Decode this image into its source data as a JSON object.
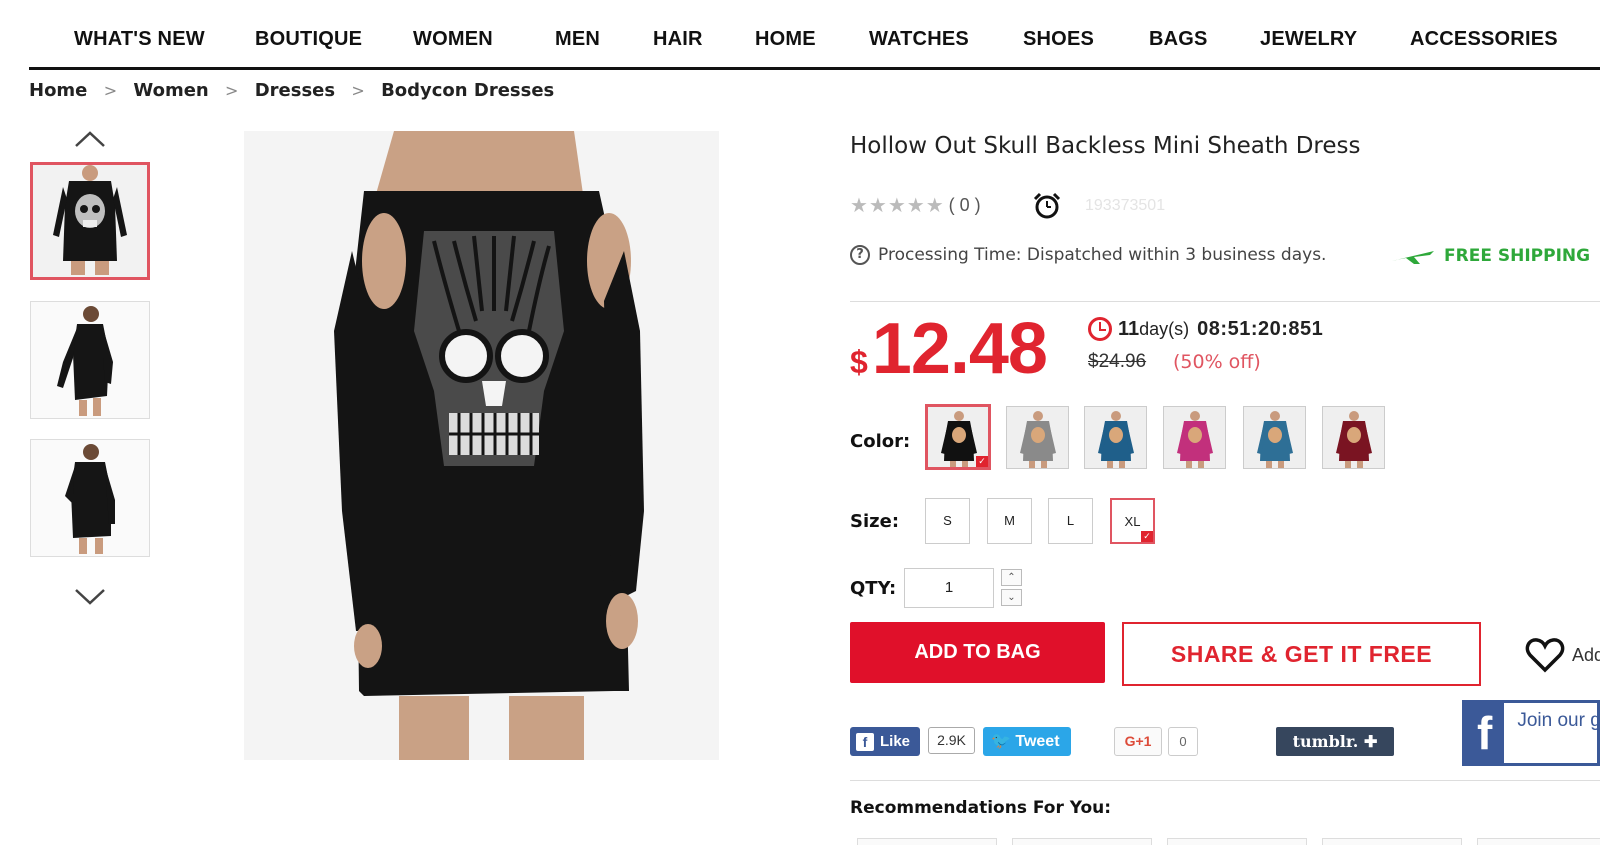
{
  "nav": {
    "items": [
      "WHAT'S NEW",
      "BOUTIQUE",
      "WOMEN",
      "MEN",
      "HAIR",
      "HOME",
      "WATCHES",
      "SHOES",
      "BAGS",
      "JEWELRY",
      "ACCESSORIES"
    ]
  },
  "breadcrumb": {
    "items": [
      "Home",
      "Women",
      "Dresses",
      "Bodycon Dresses"
    ],
    "separator": ">"
  },
  "product": {
    "title": "Hollow Out Skull Backless Mini Sheath Dress",
    "rating_stars": "★★★★★",
    "rating_count": "( 0 )",
    "sku": "193373501",
    "processing_time": "Processing Time: Dispatched within 3 business days.",
    "free_shipping": "FREE SHIPPING",
    "price_currency": "$",
    "price": "12.48",
    "timer_days": "11",
    "timer_days_unit": "day(s)",
    "timer_time": "08:51:20:851",
    "original_price": "$24.96",
    "discount": "(50% off)",
    "color_label": "Color:",
    "colors": [
      "#111111",
      "#8a8a8a",
      "#1f5f8a",
      "#c2307c",
      "#2e6f96",
      "#7a1422"
    ],
    "selected_color_index": 0,
    "size_label": "Size:",
    "sizes": [
      "S",
      "M",
      "L",
      "XL"
    ],
    "selected_size": "XL",
    "qty_label": "QTY:",
    "qty_value": "1",
    "add_to_bag": "ADD TO BAG",
    "share": "SHARE & GET IT FREE",
    "wishlist": "Add"
  },
  "social": {
    "fb_like": "Like",
    "fb_count": "2.9K",
    "tweet": "Tweet",
    "gplus": "G+1",
    "gplus_count": "0",
    "tumblr": "tumblr. ✚",
    "join_text": "Join our group"
  },
  "recommendations": {
    "title": "Recommendations For You:"
  },
  "colors": {
    "accent_red": "#e0242f",
    "free_ship_green": "#2ea83a",
    "facebook": "#3b5998",
    "twitter": "#2ba6e8",
    "tumblr": "#36465d"
  }
}
